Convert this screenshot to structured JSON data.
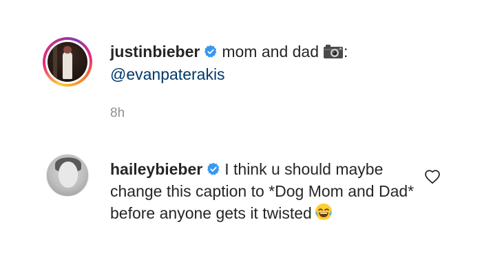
{
  "post": {
    "username": "justinbieber",
    "caption_text": "mom and dad",
    "caption_suffix": ":",
    "mention": "@evanpaterakis",
    "time": "8h"
  },
  "comment": {
    "username": "haileybieber",
    "text_line1": "I think u should",
    "text_rest": "maybe change this caption to *Dog Mom and Dad* before anyone gets it twisted"
  },
  "colors": {
    "verified": "#3897f0",
    "mention": "#00376b",
    "timestamp": "#8e8e8e"
  },
  "icons": [
    "verified-badge-icon",
    "camera-icon",
    "laughing-crying-emoji-icon",
    "heart-outline-icon"
  ]
}
